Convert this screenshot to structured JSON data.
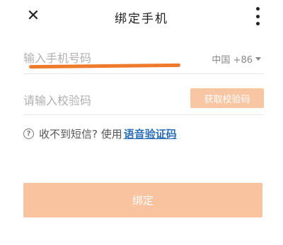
{
  "header": {
    "close_glyph": "✕",
    "title": "绑定手机"
  },
  "phone": {
    "placeholder": "输入手机号码",
    "value": "",
    "country_code": "中国 +86"
  },
  "code": {
    "placeholder": "请输入校验码",
    "value": "",
    "get_code_label": "获取校验码"
  },
  "help": {
    "icon_glyph": "?",
    "text": "收不到短信? 使用",
    "voice_link": "语音验证码"
  },
  "bind_button": {
    "label": "绑定"
  },
  "colors": {
    "accent": "#f9c3a0",
    "link": "#2d6fb6",
    "annotation_underline": "#f07a2b"
  },
  "icons": [
    "close-icon",
    "more-vertical-icon",
    "caret-down-icon",
    "question-circle-icon"
  ]
}
